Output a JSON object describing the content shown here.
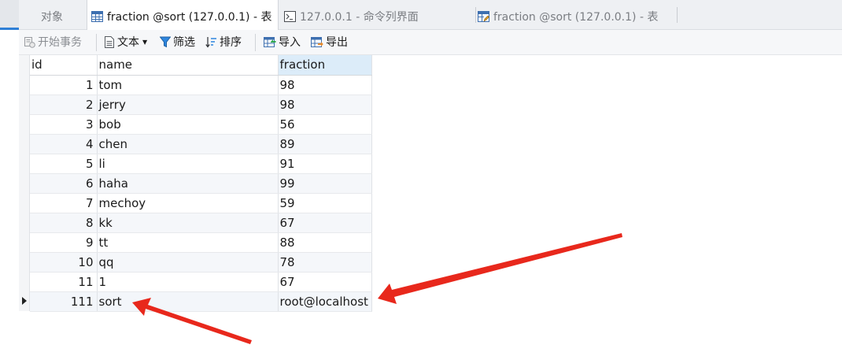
{
  "tabs": [
    {
      "label": "对象",
      "icon": "none",
      "active": false
    },
    {
      "label": "fraction @sort (127.0.0.1) - 表",
      "icon": "table-icon",
      "active": true
    },
    {
      "label": "127.0.0.1 - 命令列界面",
      "icon": "terminal-icon",
      "active": false
    },
    {
      "label": "fraction @sort (127.0.0.1) - 表",
      "icon": "table-edit-icon",
      "active": false
    }
  ],
  "toolbar": {
    "begin_transaction": "开始事务",
    "text": "文本",
    "filter": "筛选",
    "sort": "排序",
    "import": "导入",
    "export": "导出"
  },
  "grid": {
    "columns": [
      "id",
      "name",
      "fraction"
    ],
    "rows": [
      {
        "id": "1",
        "name": "tom",
        "fraction": "98"
      },
      {
        "id": "2",
        "name": "jerry",
        "fraction": "98"
      },
      {
        "id": "3",
        "name": "bob",
        "fraction": "56"
      },
      {
        "id": "4",
        "name": "chen",
        "fraction": "89"
      },
      {
        "id": "5",
        "name": "li",
        "fraction": "91"
      },
      {
        "id": "6",
        "name": "haha",
        "fraction": "99"
      },
      {
        "id": "7",
        "name": "mechoy",
        "fraction": "59"
      },
      {
        "id": "8",
        "name": "kk",
        "fraction": "67"
      },
      {
        "id": "9",
        "name": "tt",
        "fraction": "88"
      },
      {
        "id": "10",
        "name": "qq",
        "fraction": "78"
      },
      {
        "id": "11",
        "name": "1",
        "fraction": "67"
      },
      {
        "id": "111",
        "name": "sort",
        "fraction": "root@localhost"
      }
    ],
    "current_row_index": 11
  },
  "colors": {
    "accent": "#2f7fd6",
    "annotation_arrow": "#e8281c"
  }
}
